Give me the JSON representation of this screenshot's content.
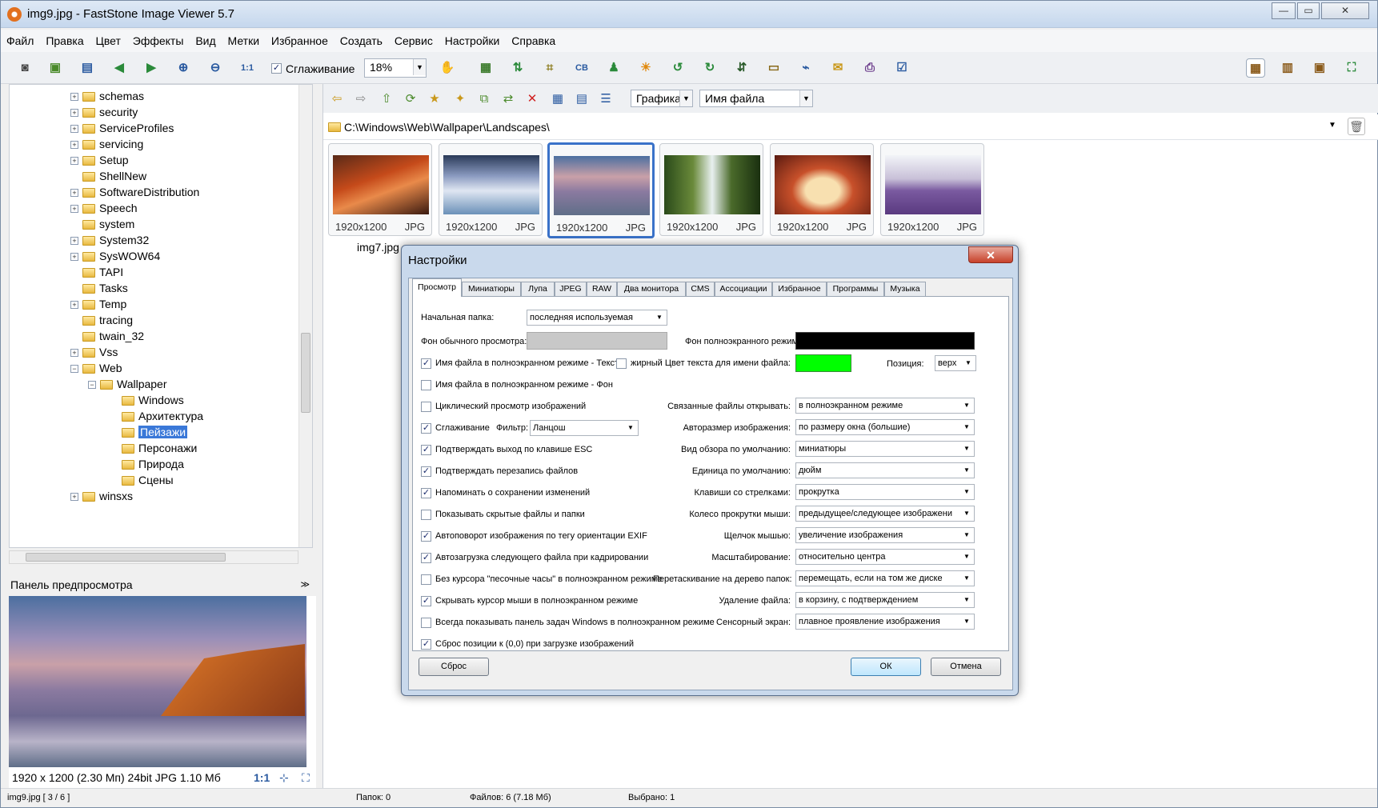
{
  "window": {
    "title": "img9.jpg  -  FastStone Image Viewer 5.7"
  },
  "menu": [
    "Файл",
    "Правка",
    "Цвет",
    "Эффекты",
    "Вид",
    "Метки",
    "Избранное",
    "Создать",
    "Сервис",
    "Настройки",
    "Справка"
  ],
  "toolbar": {
    "smoothing_label": "Сглаживание",
    "zoom_value": "18%"
  },
  "tree": {
    "items": [
      "schemas",
      "security",
      "ServiceProfiles",
      "servicing",
      "Setup",
      "ShellNew",
      "SoftwareDistribution",
      "Speech",
      "system",
      "System32",
      "SysWOW64",
      "TAPI",
      "Tasks",
      "Temp",
      "tracing",
      "twain_32",
      "Vss",
      "Web"
    ],
    "wallpaper": "Wallpaper",
    "children": [
      "Windows",
      "Архитектура",
      "Пейзажи",
      "Персонажи",
      "Природа",
      "Сцены"
    ],
    "last": "winsxs"
  },
  "preview": {
    "header": "Панель предпросмотра",
    "info": "1920 x 1200 (2.30 Мп)  24bit  JPG   1.10 Мб",
    "ratio": "1:1"
  },
  "nav": {
    "view_combo": "Графика",
    "sort_combo": "Имя файла",
    "path": "C:\\Windows\\Web\\Wallpaper\\Landscapes\\"
  },
  "thumbs": [
    {
      "dim": "1920x1200",
      "ext": "JPG"
    },
    {
      "dim": "1920x1200",
      "ext": "JPG"
    },
    {
      "dim": "1920x1200",
      "ext": "JPG"
    },
    {
      "dim": "1920x1200",
      "ext": "JPG"
    },
    {
      "dim": "1920x1200",
      "ext": "JPG"
    },
    {
      "dim": "1920x1200",
      "ext": "JPG"
    }
  ],
  "thumb_caption": "img7.jpg",
  "status": {
    "file": "img9.jpg [ 3 / 6 ]",
    "folders": "Папок: 0",
    "files": "Файлов: 6 (7.18 Мб)",
    "selected": "Выбрано: 1"
  },
  "dialog": {
    "title": "Настройки",
    "tabs": [
      "Просмотр",
      "Миниатюры",
      "Лупа",
      "JPEG",
      "RAW",
      "Два монитора",
      "CMS",
      "Ассоциации",
      "Избранное",
      "Программы",
      "Музыка"
    ],
    "start_folder_label": "Начальная папка:",
    "start_folder_value": "последняя используемая",
    "bg_normal_label": "Фон обычного просмотра:",
    "bg_full_label": "Фон полноэкранного режима:",
    "bg_normal_color": "#c8c8c8",
    "bg_full_color": "#000000",
    "filename_text_label": "Имя файла в полноэкранном режиме  -  Текст",
    "bold_label": "жирный",
    "text_color_label": "Цвет текста для имени файла:",
    "text_color": "#00ff00",
    "position_label": "Позиция:",
    "position_value": "верх",
    "filename_bg_label": "Имя файла в полноэкранном режиме  -  Фон",
    "loop_label": "Циклический просмотр изображений",
    "smoothing_label": "Сглаживание",
    "filter_label": "Фильтр:",
    "filter_value": "Ланцош",
    "checks": [
      "Подтверждать выход по клавише ESC",
      "Подтверждать перезапись файлов",
      "Напоминать о сохранении изменений",
      "Показывать скрытые файлы и папки",
      "Автоповорот изображения по тегу ориентации EXIF",
      "Автозагрузка следующего файла при кадрировании",
      "Без курсора \"песочные часы\" в полноэкранном режиме",
      "Скрывать курсор мыши в полноэкранном режиме",
      "Всегда показывать панель задач Windows в полноэкранном режиме",
      "Сброс позиции к (0,0) при загрузке изображений"
    ],
    "checks_state": [
      true,
      true,
      true,
      false,
      true,
      true,
      false,
      true,
      false,
      true
    ],
    "options": [
      {
        "label": "Связанные файлы открывать:",
        "value": "в полноэкранном режиме"
      },
      {
        "label": "Авторазмер изображения:",
        "value": "по размеру окна (большие)"
      },
      {
        "label": "Вид обзора по умолчанию:",
        "value": "миниатюры"
      },
      {
        "label": "Единица по умолчанию:",
        "value": "дюйм"
      },
      {
        "label": "Клавиши со стрелками:",
        "value": "прокрутка"
      },
      {
        "label": "Колесо прокрутки мыши:",
        "value": "предыдущее/следующее изображени"
      },
      {
        "label": "Щелчок мышью:",
        "value": "увеличение изображения"
      },
      {
        "label": "Масштабирование:",
        "value": "относительно центра"
      },
      {
        "label": "Перетаскивание на дерево папок:",
        "value": "перемещать, если на том же диске"
      },
      {
        "label": "Удаление файла:",
        "value": "в корзину, с подтверждением"
      },
      {
        "label": "Сенсорный экран:",
        "value": "плавное проявление изображения"
      }
    ],
    "reset_button": "Сброс",
    "ok_button": "ОК",
    "cancel_button": "Отмена"
  }
}
